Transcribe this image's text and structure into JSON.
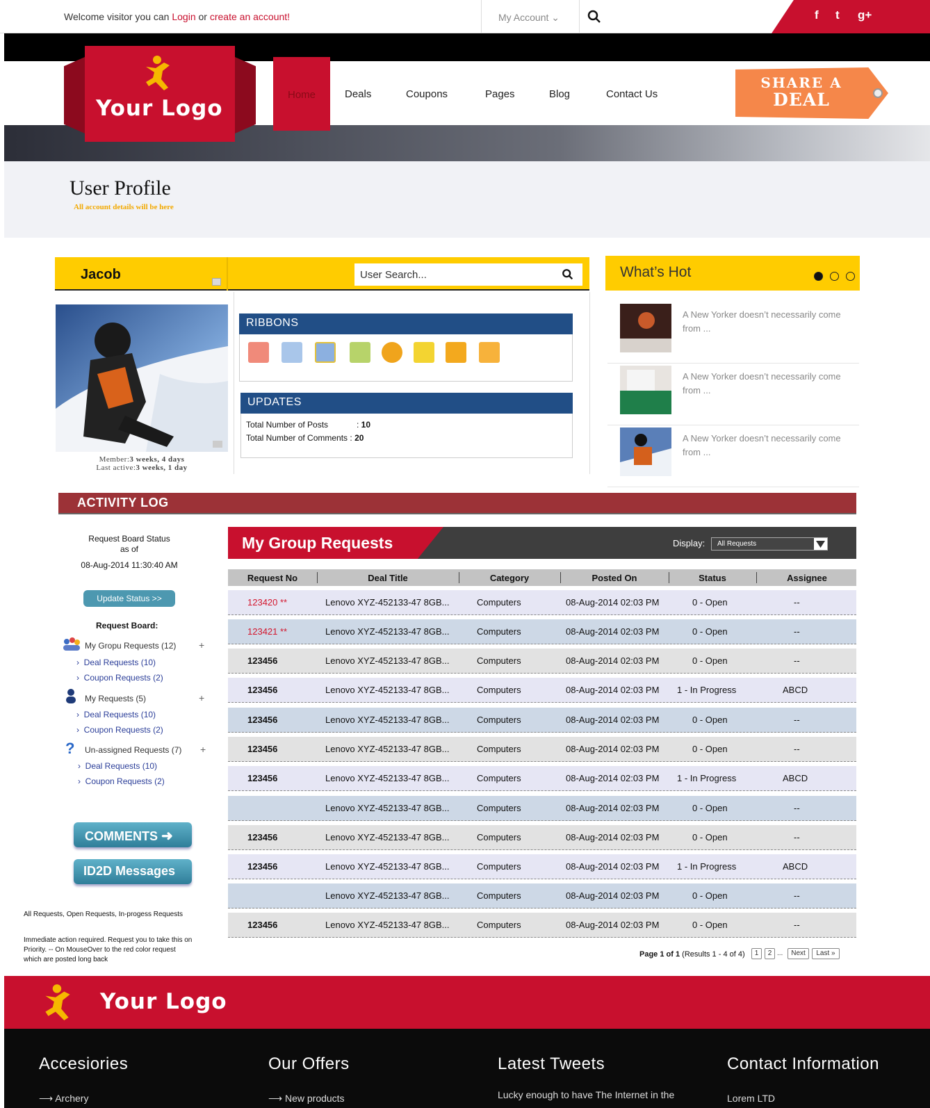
{
  "topbar": {
    "welcome_prefix": "Welcome visitor you can",
    "login": "Login",
    "or": "or",
    "create": "create an account!",
    "my_account": "My Account",
    "social": [
      "f",
      "t",
      "g+"
    ]
  },
  "brand": {
    "logo_text": "Your Logo",
    "primary_color": "#c8102e",
    "accent_color": "#ffcc00"
  },
  "nav": {
    "items": [
      "Home",
      "Deals",
      "Coupons",
      "Pages",
      "Blog",
      "Contact Us"
    ],
    "share_line1": "SHARE A",
    "share_line2": "DEAL"
  },
  "page": {
    "title": "User Profile",
    "subtitle": "All account details will be here"
  },
  "profile": {
    "name": "Jacob",
    "search_placeholder": "User Search...",
    "member_label": "Member:",
    "member_value": "3 weeks, 4 days",
    "last_active_label": "Last active:",
    "last_active_value": "3 weeks, 1 day",
    "ribbons_title": "RIBBONS",
    "updates_title": "UPDATES",
    "posts_label": "Total Number of Posts",
    "posts_value": "10",
    "comments_label": "Total Number of Comments",
    "comments_value": "20"
  },
  "hot": {
    "title": "What’s Hot",
    "items": [
      "A New Yorker doesn’t necessarily come from ...",
      "A New Yorker doesn’t necessarily come from ...",
      "A New Yorker doesn’t necessarily come from ..."
    ]
  },
  "activity": {
    "title": "ACTIVITY LOG",
    "status_line1": "Request Board Status",
    "status_line2": "as of",
    "status_date": "08-Aug-2014 11:30:40 AM",
    "update_btn": "Update Status >>",
    "board_title": "Request Board:",
    "groups": [
      {
        "label": "My Gropu Requests (12)",
        "deal": "Deal Requests (10)",
        "coupon": "Coupon Requests (2)"
      },
      {
        "label": "My Requests (5)",
        "deal": "Deal Requests (10)",
        "coupon": "Coupon Requests (2)"
      },
      {
        "label": "Un-assigned Requests (7)",
        "deal": "Deal Requests (10)",
        "coupon": "Coupon Requests (2)"
      }
    ],
    "comments_btn": "COMMENTS",
    "messages_btn": "ID2D Messages",
    "note1": "All Requests, Open Requests, In-progess Requests",
    "note2_l1": "Immediate action required. Request you to take this on",
    "note2_l2": "Priority. -- On MouseOver to the red color request",
    "note2_l3": "which are posted long back"
  },
  "requests": {
    "title": "My Group Requests",
    "display_label": "Display:",
    "display_value": "All Requests",
    "columns": [
      "Request No",
      "Deal Title",
      "Category",
      "Posted On",
      "Status",
      "Assignee"
    ],
    "rows": [
      {
        "no": "123420 **",
        "title": "Lenovo XYZ-452133-47 8GB...",
        "cat": "Computers",
        "date": "08-Aug-2014 02:03 PM",
        "status": "0 - Open",
        "assignee": "--"
      },
      {
        "no": "123421 **",
        "title": "Lenovo XYZ-452133-47 8GB...",
        "cat": "Computers",
        "date": "08-Aug-2014 02:03 PM",
        "status": "0 - Open",
        "assignee": "--"
      },
      {
        "no": "123456",
        "title": "Lenovo XYZ-452133-47 8GB...",
        "cat": "Computers",
        "date": "08-Aug-2014 02:03 PM",
        "status": "0 - Open",
        "assignee": "--"
      },
      {
        "no": "123456",
        "title": "Lenovo XYZ-452133-47 8GB...",
        "cat": "Computers",
        "date": "08-Aug-2014 02:03 PM",
        "status": "1 - In Progress",
        "assignee": "ABCD"
      },
      {
        "no": "123456",
        "title": "Lenovo XYZ-452133-47 8GB...",
        "cat": "Computers",
        "date": "08-Aug-2014 02:03 PM",
        "status": "0 - Open",
        "assignee": "--"
      },
      {
        "no": "123456",
        "title": "Lenovo XYZ-452133-47 8GB...",
        "cat": "Computers",
        "date": "08-Aug-2014 02:03 PM",
        "status": "0 - Open",
        "assignee": "--"
      },
      {
        "no": "123456",
        "title": "Lenovo XYZ-452133-47 8GB...",
        "cat": "Computers",
        "date": "08-Aug-2014 02:03 PM",
        "status": "1 - In Progress",
        "assignee": "ABCD"
      },
      {
        "no": "",
        "title": "Lenovo XYZ-452133-47 8GB...",
        "cat": "Computers",
        "date": "08-Aug-2014 02:03 PM",
        "status": "0 - Open",
        "assignee": "--"
      },
      {
        "no": "123456",
        "title": "Lenovo XYZ-452133-47 8GB...",
        "cat": "Computers",
        "date": "08-Aug-2014 02:03 PM",
        "status": "0 - Open",
        "assignee": "--"
      },
      {
        "no": "123456",
        "title": "Lenovo XYZ-452133-47 8GB...",
        "cat": "Computers",
        "date": "08-Aug-2014 02:03 PM",
        "status": "1 - In Progress",
        "assignee": "ABCD"
      },
      {
        "no": "",
        "title": "Lenovo XYZ-452133-47 8GB...",
        "cat": "Computers",
        "date": "08-Aug-2014 02:03 PM",
        "status": "0 - Open",
        "assignee": "--"
      },
      {
        "no": "123456",
        "title": "Lenovo XYZ-452133-47 8GB...",
        "cat": "Computers",
        "date": "08-Aug-2014 02:03 PM",
        "status": "0 - Open",
        "assignee": "--"
      }
    ],
    "row_colors": [
      "#e6e6f4",
      "#cdd8e6",
      "#e2e2e2",
      "#e6e6f4",
      "#cdd8e6",
      "#e2e2e2",
      "#e6e6f4",
      "#cdd8e6",
      "#e2e2e2",
      "#e6e6f4",
      "#cdd8e6",
      "#e2e2e2"
    ],
    "pager_page": "Page",
    "pager_of": "1 of 1",
    "pager_results": "(Results 1 - 4 of 4)",
    "pager_btns": [
      "1",
      "2",
      "...",
      "Next",
      "Last »"
    ]
  },
  "footer": {
    "logo_text": "Your Logo",
    "headings": [
      "Accesiories",
      "Our Offers",
      "Latest Tweets",
      "Contact Information"
    ],
    "link1": "Archery",
    "link2": "New products",
    "tweet": "Lucky enough to have The Internet in the",
    "contact": "Lorem LTD"
  }
}
